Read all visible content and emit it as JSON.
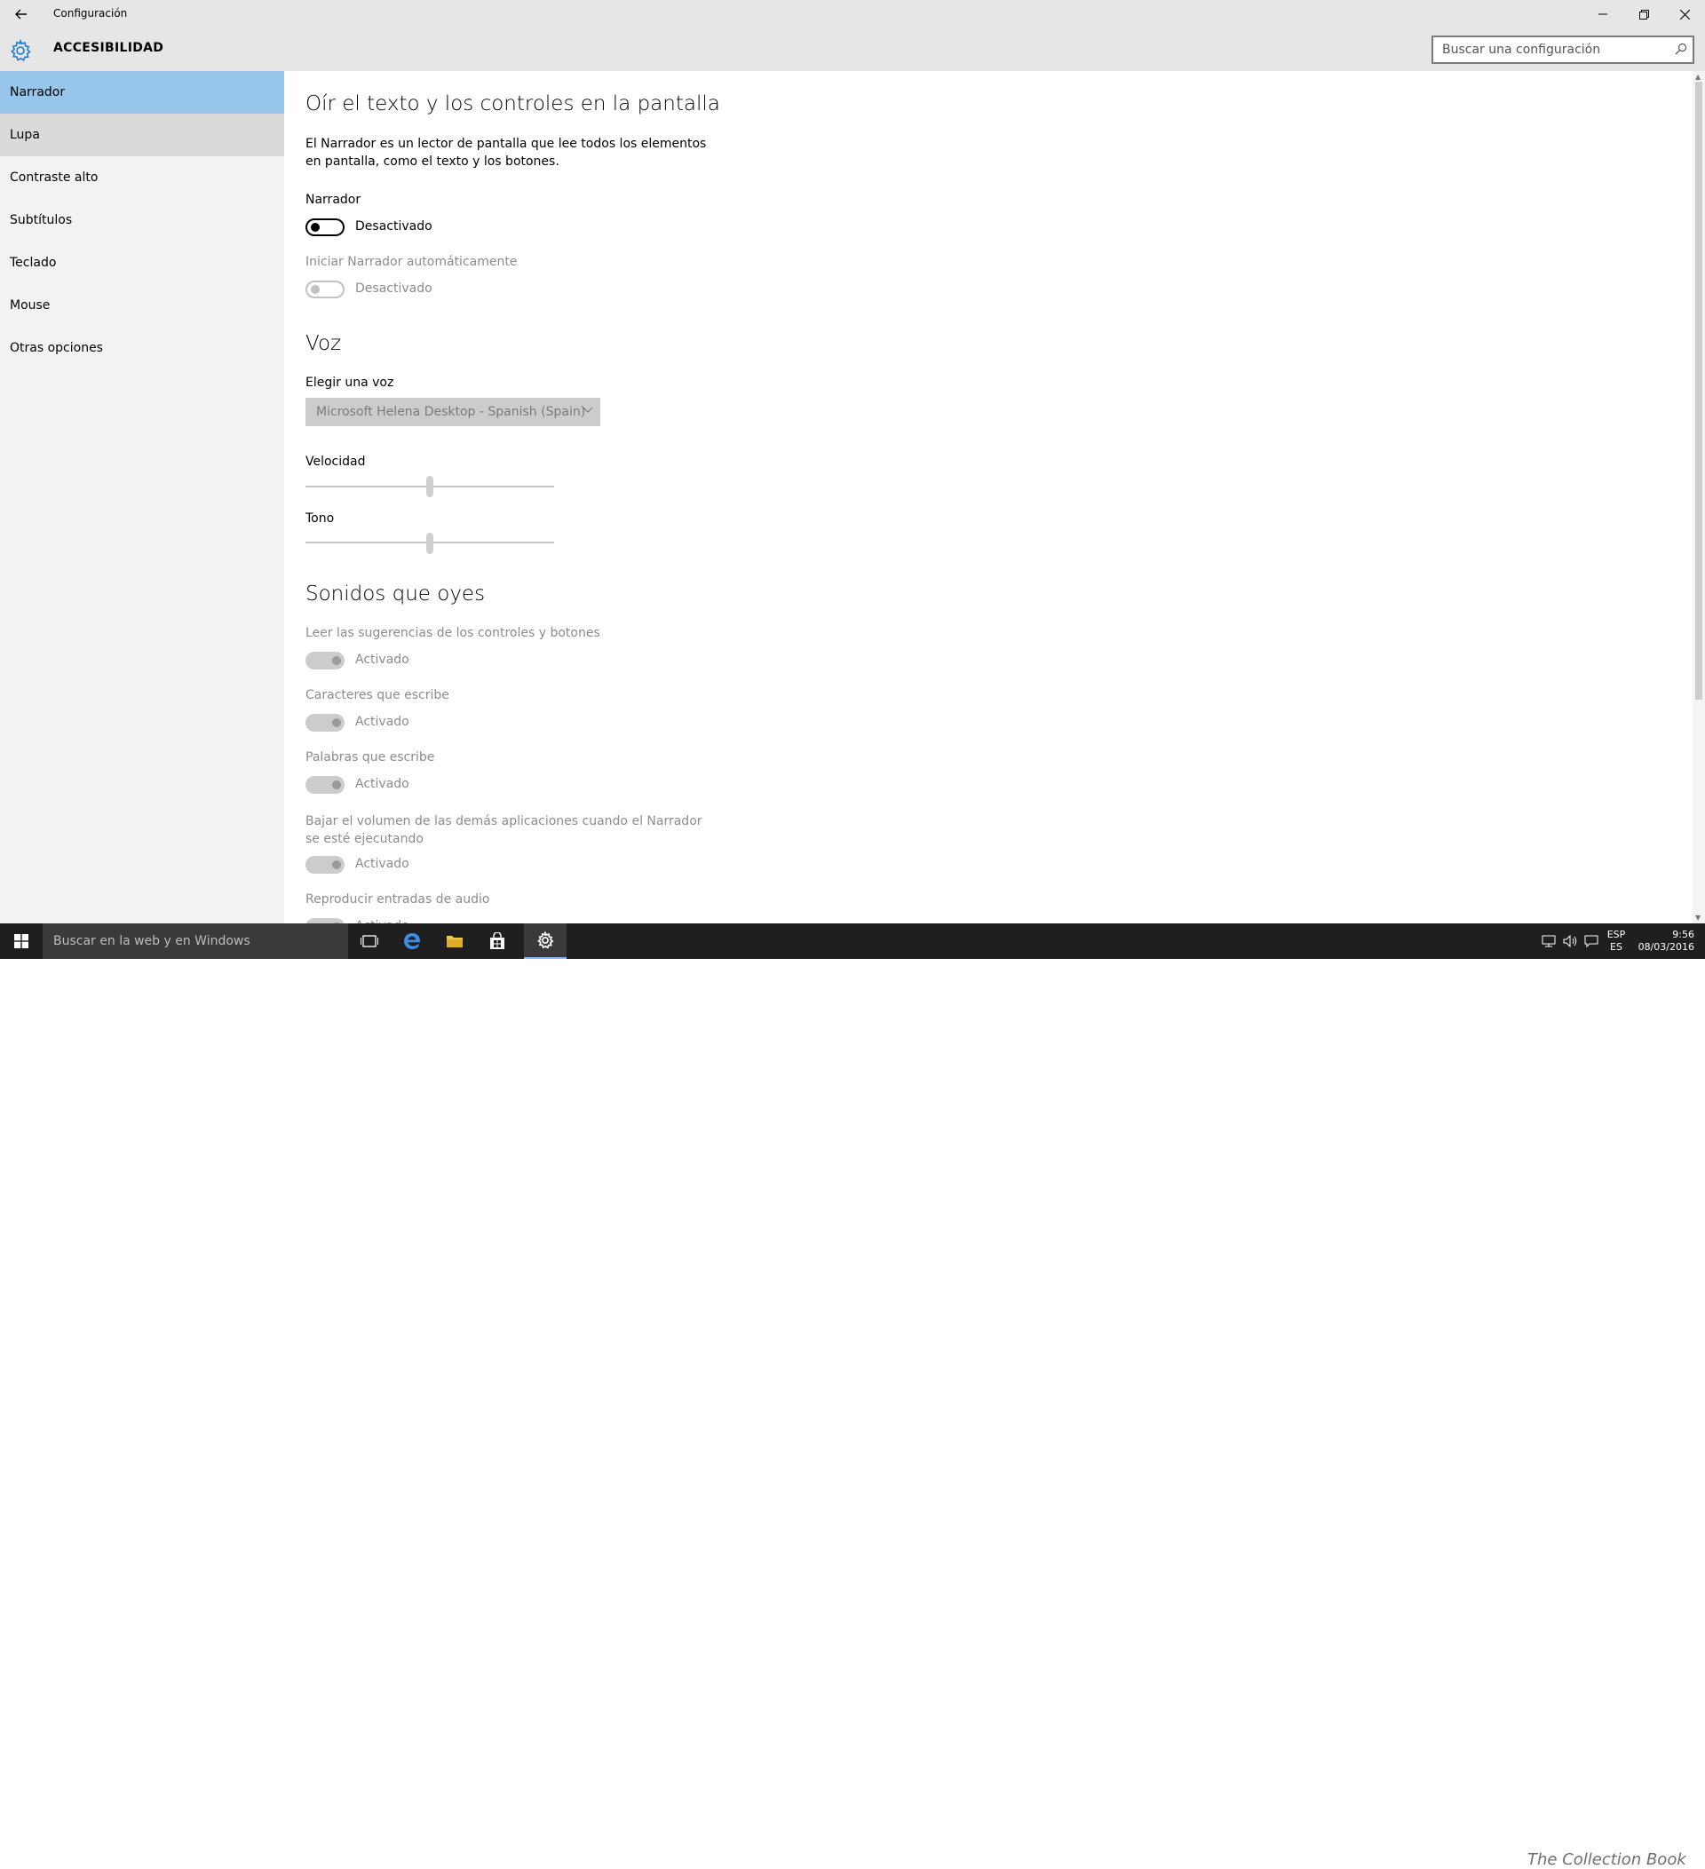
{
  "window": {
    "title": "Configuración"
  },
  "header": {
    "section": "ACCESIBILIDAD",
    "search_placeholder": "Buscar una configuración"
  },
  "sidebar": {
    "items": [
      {
        "label": "Narrador",
        "state": "selected"
      },
      {
        "label": "Lupa",
        "state": "hover"
      },
      {
        "label": "Contraste alto"
      },
      {
        "label": "Subtítulos"
      },
      {
        "label": "Teclado"
      },
      {
        "label": "Mouse"
      },
      {
        "label": "Otras opciones"
      }
    ]
  },
  "content": {
    "heading_main": "Oír el texto y los controles en la pantalla",
    "description": "El Narrador es un lector de pantalla que lee todos los elementos en pantalla, como el texto y los botones.",
    "narrator": {
      "label": "Narrador",
      "state": "Desactivado"
    },
    "auto_start": {
      "label": "Iniciar Narrador automáticamente",
      "state": "Desactivado"
    },
    "voice": {
      "heading": "Voz",
      "choose_label": "Elegir una voz",
      "selected_voice": "Microsoft Helena Desktop - Spanish (Spain)",
      "speed_label": "Velocidad",
      "speed_value": 50,
      "pitch_label": "Tono",
      "pitch_value": 50
    },
    "sounds": {
      "heading": "Sonidos que oyes",
      "options": [
        {
          "label": "Leer las sugerencias de los controles y botones",
          "state": "Activado"
        },
        {
          "label": "Caracteres que escribe",
          "state": "Activado"
        },
        {
          "label": "Palabras que escribe",
          "state": "Activado"
        },
        {
          "label": "Bajar el volumen de las demás aplicaciones cuando el Narrador se esté ejecutando",
          "state": "Activado"
        },
        {
          "label": "Reproducir entradas de audio",
          "state": "Activado"
        }
      ]
    }
  },
  "taskbar": {
    "search_text": "Buscar en la web y en Windows",
    "lang_top": "ESP",
    "lang_bottom": "ES",
    "time": "9:56",
    "date": "08/03/2016",
    "watermark": "The Collection Book"
  },
  "colors": {
    "accent": "#98c6ea",
    "sidebar_bg": "#f2f2f2",
    "titlebar_bg": "#e6e6e6",
    "taskbar_bg": "#1f1f1f"
  }
}
